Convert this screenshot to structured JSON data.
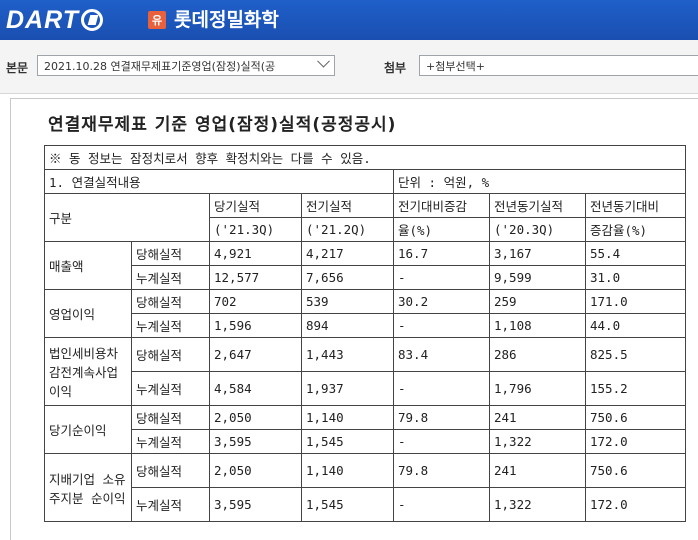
{
  "header": {
    "logo_text": "DART",
    "company_badge": "유",
    "company_name": "롯데정밀화학"
  },
  "toolbar": {
    "report_label": "본문",
    "report_select": "2021.10.28  연결재무제표기준영업(잠정)실적(공",
    "attach_label": "첨부",
    "attach_select": "+첨부선택+"
  },
  "document": {
    "title": "연결재무제표 기준 영업(잠정)실적(공정공시)",
    "notice": "※ 동 정보는 잠정치로서 향후 확정치와는 다를 수 있음.",
    "section": "1. 연결실적내용",
    "unit": "단위 : 억원, %",
    "headers": {
      "category": "구분",
      "current": "당기실적",
      "current_period": "('21.3Q)",
      "previous": "전기실적",
      "previous_period": "('21.2Q)",
      "qoq_1": "전기대비증감",
      "qoq_2": "율(%)",
      "yoy": "전년동기실적",
      "yoy_period": "('20.3Q)",
      "yoy_rate_1": "전년동기대비",
      "yoy_rate_2": "증감율(%)"
    },
    "rows": [
      {
        "item": "매출액",
        "sub": [
          {
            "type": "당해실적",
            "cur": "4,921",
            "prev": "4,217",
            "qoq": "16.7",
            "yoy": "3,167",
            "yoyr": "55.4"
          },
          {
            "type": "누계실적",
            "cur": "12,577",
            "prev": "7,656",
            "qoq": "-",
            "yoy": "9,599",
            "yoyr": "31.0"
          }
        ]
      },
      {
        "item": "영업이익",
        "sub": [
          {
            "type": "당해실적",
            "cur": "702",
            "prev": "539",
            "qoq": "30.2",
            "yoy": "259",
            "yoyr": "171.0"
          },
          {
            "type": "누계실적",
            "cur": "1,596",
            "prev": "894",
            "qoq": "-",
            "yoy": "1,108",
            "yoyr": "44.0"
          }
        ]
      },
      {
        "item": "법인세비용차감전계속사업이익",
        "sub": [
          {
            "type": "당해실적",
            "cur": "2,647",
            "prev": "1,443",
            "qoq": "83.4",
            "yoy": "286",
            "yoyr": "825.5"
          },
          {
            "type": "누계실적",
            "cur": "4,584",
            "prev": "1,937",
            "qoq": "-",
            "yoy": "1,796",
            "yoyr": "155.2"
          }
        ]
      },
      {
        "item": "당기순이익",
        "sub": [
          {
            "type": "당해실적",
            "cur": "2,050",
            "prev": "1,140",
            "qoq": "79.8",
            "yoy": "241",
            "yoyr": "750.6"
          },
          {
            "type": "누계실적",
            "cur": "3,595",
            "prev": "1,545",
            "qoq": "-",
            "yoy": "1,322",
            "yoyr": "172.0"
          }
        ]
      },
      {
        "item": "지배기업 소유주지분 순이익",
        "sub": [
          {
            "type": "당해실적",
            "cur": "2,050",
            "prev": "1,140",
            "qoq": "79.8",
            "yoy": "241",
            "yoyr": "750.6"
          },
          {
            "type": "누계실적",
            "cur": "3,595",
            "prev": "1,545",
            "qoq": "-",
            "yoy": "1,322",
            "yoyr": "172.0"
          }
        ]
      }
    ]
  }
}
